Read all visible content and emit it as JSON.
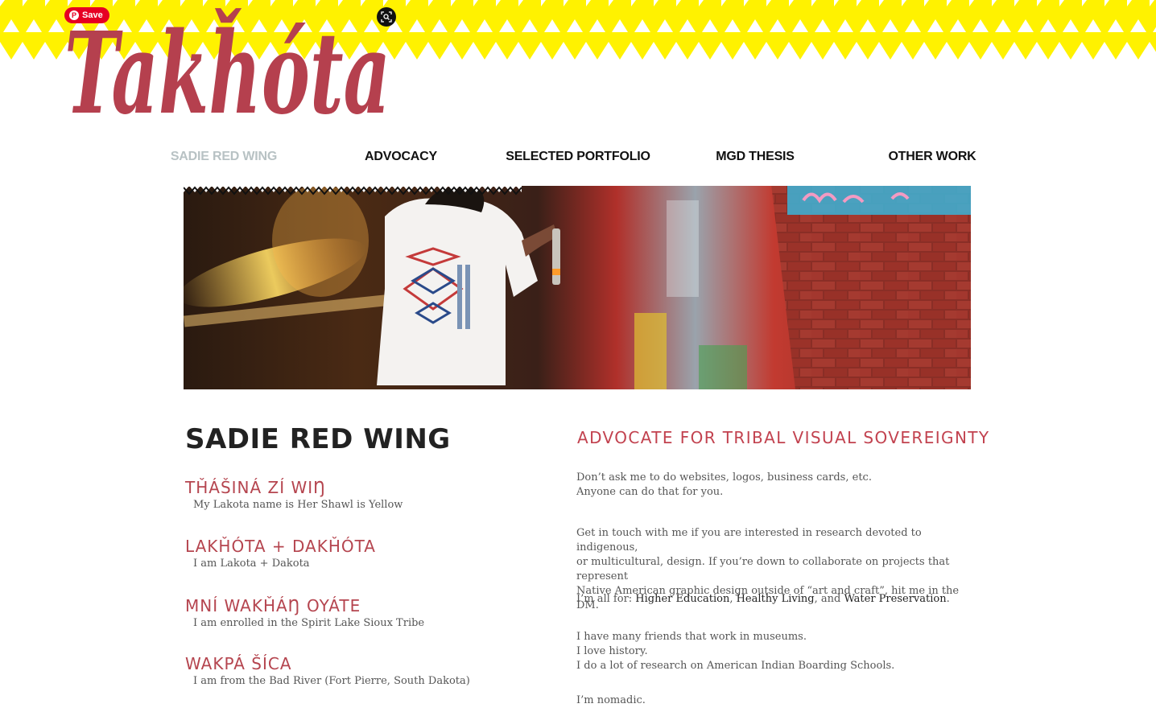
{
  "brand": {
    "logo_text": "Takȟóta",
    "band_color": "#fff200",
    "logo_color": "#b5404e"
  },
  "overlay": {
    "save_label": "Save",
    "lens_icon": "visual-search-icon"
  },
  "nav": {
    "items": [
      {
        "label": "SADIE RED WING",
        "active": true
      },
      {
        "label": "ADVOCACY",
        "active": false
      },
      {
        "label": "SELECTED PORTFOLIO",
        "active": false
      },
      {
        "label": "MGD THESIS",
        "active": false
      },
      {
        "label": "OTHER WORK",
        "active": false
      }
    ]
  },
  "left": {
    "title": "SADIE RED WING",
    "facts": [
      {
        "heading": "TȞÁŠINÁ ZÍ WIŊ",
        "text": "My Lakota name is Her Shawl is Yellow"
      },
      {
        "heading": "LAKȞÓTA + DAKȞÓTA",
        "text": "I am Lakota + Dakota"
      },
      {
        "heading": "MNÍ WAKȞÁŊ OYÁTE",
        "text": "I am enrolled in the Spirit Lake Sioux Tribe"
      },
      {
        "heading": "WAKPÁ ŠÍCA",
        "text": "I am from the Bad River (Fort Pierre, South Dakota)"
      }
    ]
  },
  "right": {
    "title": "ADVOCATE FOR TRIBAL VISUAL SOVEREIGNTY",
    "p1": [
      "Don’t ask me to do websites, logos, business cards, etc.",
      "Anyone can do that for you."
    ],
    "p2": [
      "Get in touch with me if you are interested in research devoted to indigenous,",
      "or multicultural, design. If you’re down to collaborate on projects that represent",
      "Native American graphic design outside of “art and craft”, hit me in the DM."
    ],
    "p3": {
      "prefix": "I’m all for: ",
      "item1": "Higher Education",
      "sep1": ", ",
      "item2": "Healthy Living",
      "sep2": ", and ",
      "item3": "Water Preservation",
      "suffix": "."
    },
    "p4": [
      "I have many friends that work in museums.",
      "I love history.",
      "I do a lot of research on American Indian Boarding Schools."
    ],
    "p5": "I’m nomadic."
  }
}
